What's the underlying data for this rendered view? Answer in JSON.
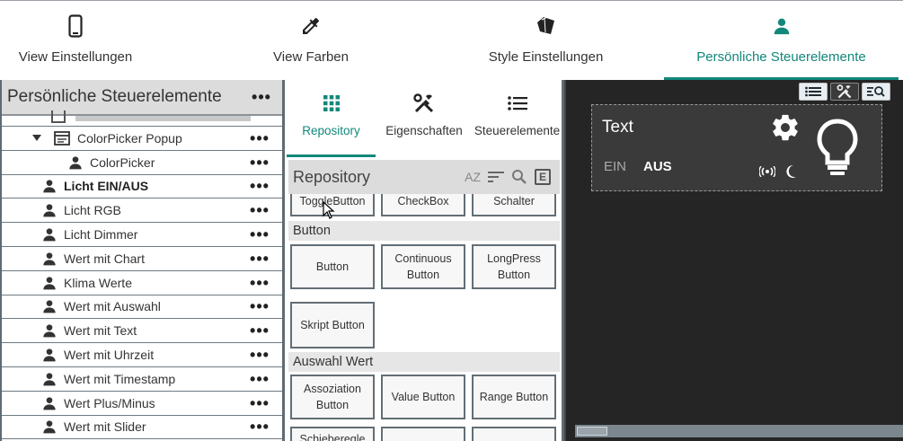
{
  "top_tabs": [
    {
      "label": "View Einstellungen",
      "icon": "smartphone-icon"
    },
    {
      "label": "View Farben",
      "icon": "eyedropper-icon"
    },
    {
      "label": "Style Einstellungen",
      "icon": "style-icon"
    },
    {
      "label": "Persönliche Steuerelemente",
      "icon": "person-icon",
      "active": true
    }
  ],
  "left_panel": {
    "title": "Persönliche Steuerelemente",
    "menu": "•••",
    "items": [
      {
        "label": "ColorPicker Popup"
      },
      {
        "label": "ColorPicker"
      },
      {
        "label": "Licht EIN/AUS"
      },
      {
        "label": "Licht RGB"
      },
      {
        "label": "Licht Dimmer"
      },
      {
        "label": "Wert mit Chart"
      },
      {
        "label": "Klima Werte"
      },
      {
        "label": "Wert mit Auswahl"
      },
      {
        "label": "Wert mit Text"
      },
      {
        "label": "Wert mit Uhrzeit"
      },
      {
        "label": "Wert mit Timestamp"
      },
      {
        "label": "Wert Plus/Minus"
      },
      {
        "label": "Wert mit Slider"
      }
    ]
  },
  "mid_tabs": [
    {
      "label": "Repository",
      "icon": "grid-icon",
      "active": true
    },
    {
      "label": "Eigenschaften",
      "icon": "tools-icon"
    },
    {
      "label": "Steuerelemente",
      "icon": "list-icon"
    }
  ],
  "repository": {
    "title": "Repository",
    "sort_az": "AZ",
    "filter_e": "E",
    "row0": [
      "ToggleButton",
      "CheckBox",
      "Schalter"
    ],
    "cat_button": "Button",
    "row1": [
      "Button",
      "Continuous\nButton",
      "LongPress\nButton"
    ],
    "row2": [
      "Skript Button"
    ],
    "cat_auswahl": "Auswahl Wert",
    "row3": [
      "Assoziation\nButton",
      "Value Button",
      "Range Button"
    ],
    "row4": [
      "Schieberegle"
    ]
  },
  "preview": {
    "text": "Text",
    "ein": "EIN",
    "aus": "AUS"
  },
  "colors": {
    "accent": "#13877a",
    "preview_bg": "#252525",
    "widget_bg": "#3a3a3a"
  }
}
